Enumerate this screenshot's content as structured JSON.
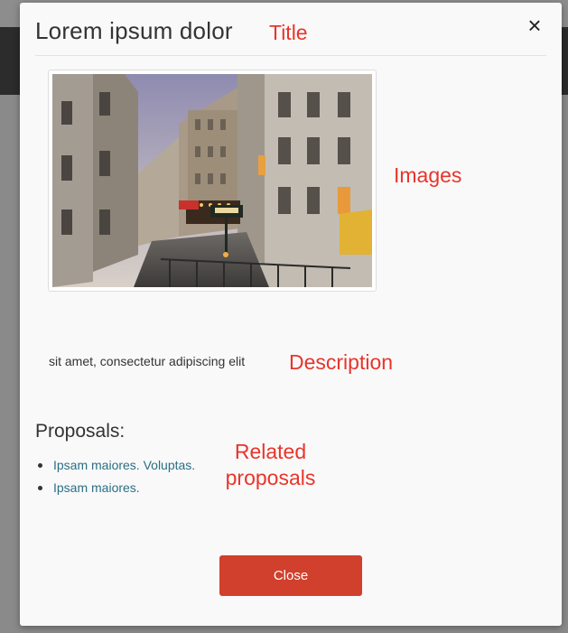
{
  "modal": {
    "title": "Lorem ipsum dolor",
    "close_icon": "×",
    "image": {
      "alt": "Paris street scene with Metropolitain sign"
    },
    "description": "sit amet, consectetur adipiscing elit",
    "proposals_heading": "Proposals:",
    "proposals": [
      {
        "label": "Ipsam maiores. Voluptas."
      },
      {
        "label": "Ipsam maiores."
      }
    ],
    "close_button": "Close"
  },
  "annotations": {
    "title": "Title",
    "images": "Images",
    "description": "Description",
    "related_line1": "Related",
    "related_line2": "proposals",
    "color": "#e8352b"
  },
  "colors": {
    "primary_button": "#d0402c",
    "link": "#2a6f84",
    "modal_bg": "#f9f9f9"
  }
}
